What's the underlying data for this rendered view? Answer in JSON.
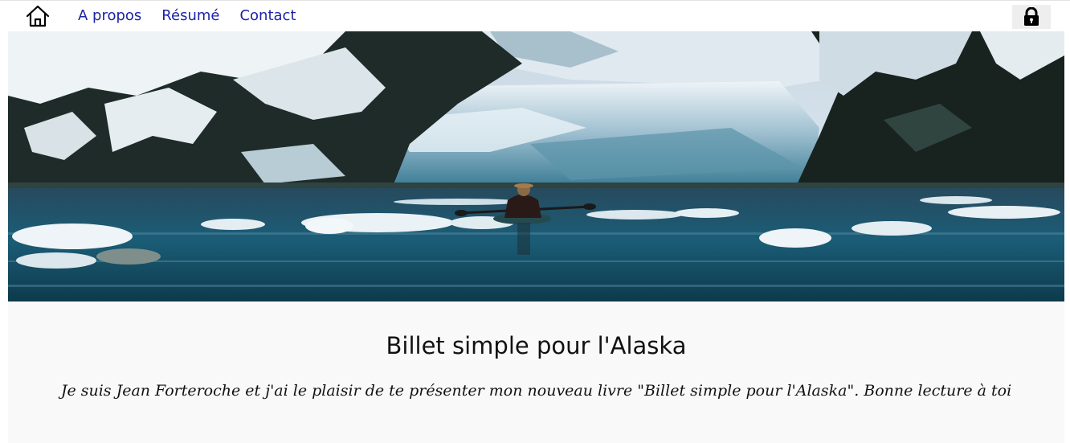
{
  "nav": {
    "home_icon": "home-icon",
    "links": [
      "A propos",
      "Résumé",
      "Contact"
    ],
    "link_color": "#1d23a6",
    "lock_icon": "lock-icon"
  },
  "hero": {
    "description_icon": "kayak-glacier-photo"
  },
  "main": {
    "title": "Billet simple pour l'Alaska",
    "subtitle": "Je suis Jean Forteroche et j'ai le plaisir de te présenter mon nouveau livre \"Billet simple pour l'Alaska\". Bonne lecture à toi"
  }
}
